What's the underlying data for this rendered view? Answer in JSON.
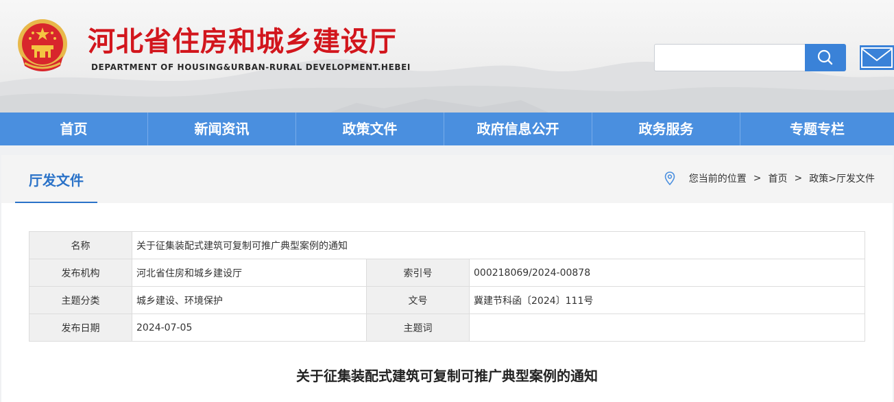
{
  "header": {
    "title": "河北省住房和城乡建设厅",
    "subtitle": "DEPARTMENT OF HOUSING&URBAN-RURAL DEVELOPMENT.HEBEI",
    "search_placeholder": "",
    "emblem_icon": "national-emblem",
    "search_icon": "magnifier",
    "mail_icon": "envelope"
  },
  "colors": {
    "title_red": "#d2161d",
    "nav_blue": "#4a8fdf",
    "accent_blue": "#2a72c8"
  },
  "nav": {
    "items": [
      "首页",
      "新闻资讯",
      "政策文件",
      "政府信息公开",
      "政务服务",
      "专题专栏"
    ]
  },
  "section": {
    "title": "厅发文件"
  },
  "breadcrumb": {
    "prefix": "您当前的位置",
    "sep": ">",
    "home": "首页",
    "path": "政策>厅发文件"
  },
  "meta": {
    "name_label": "名称",
    "name_value": "关于征集装配式建筑可复制可推广典型案例的通知",
    "org_label": "发布机构",
    "org_value": "河北省住房和城乡建设厅",
    "index_label": "索引号",
    "index_value": "000218069/2024-00878",
    "topic_label": "主题分类",
    "topic_value": "城乡建设、环境保护",
    "docno_label": "文号",
    "docno_value": "冀建节科函〔2024〕111号",
    "date_label": "发布日期",
    "date_value": "2024-07-05",
    "keyword_label": "主题词",
    "keyword_value": ""
  },
  "document": {
    "title": "关于征集装配式建筑可复制可推广典型案例的通知"
  }
}
